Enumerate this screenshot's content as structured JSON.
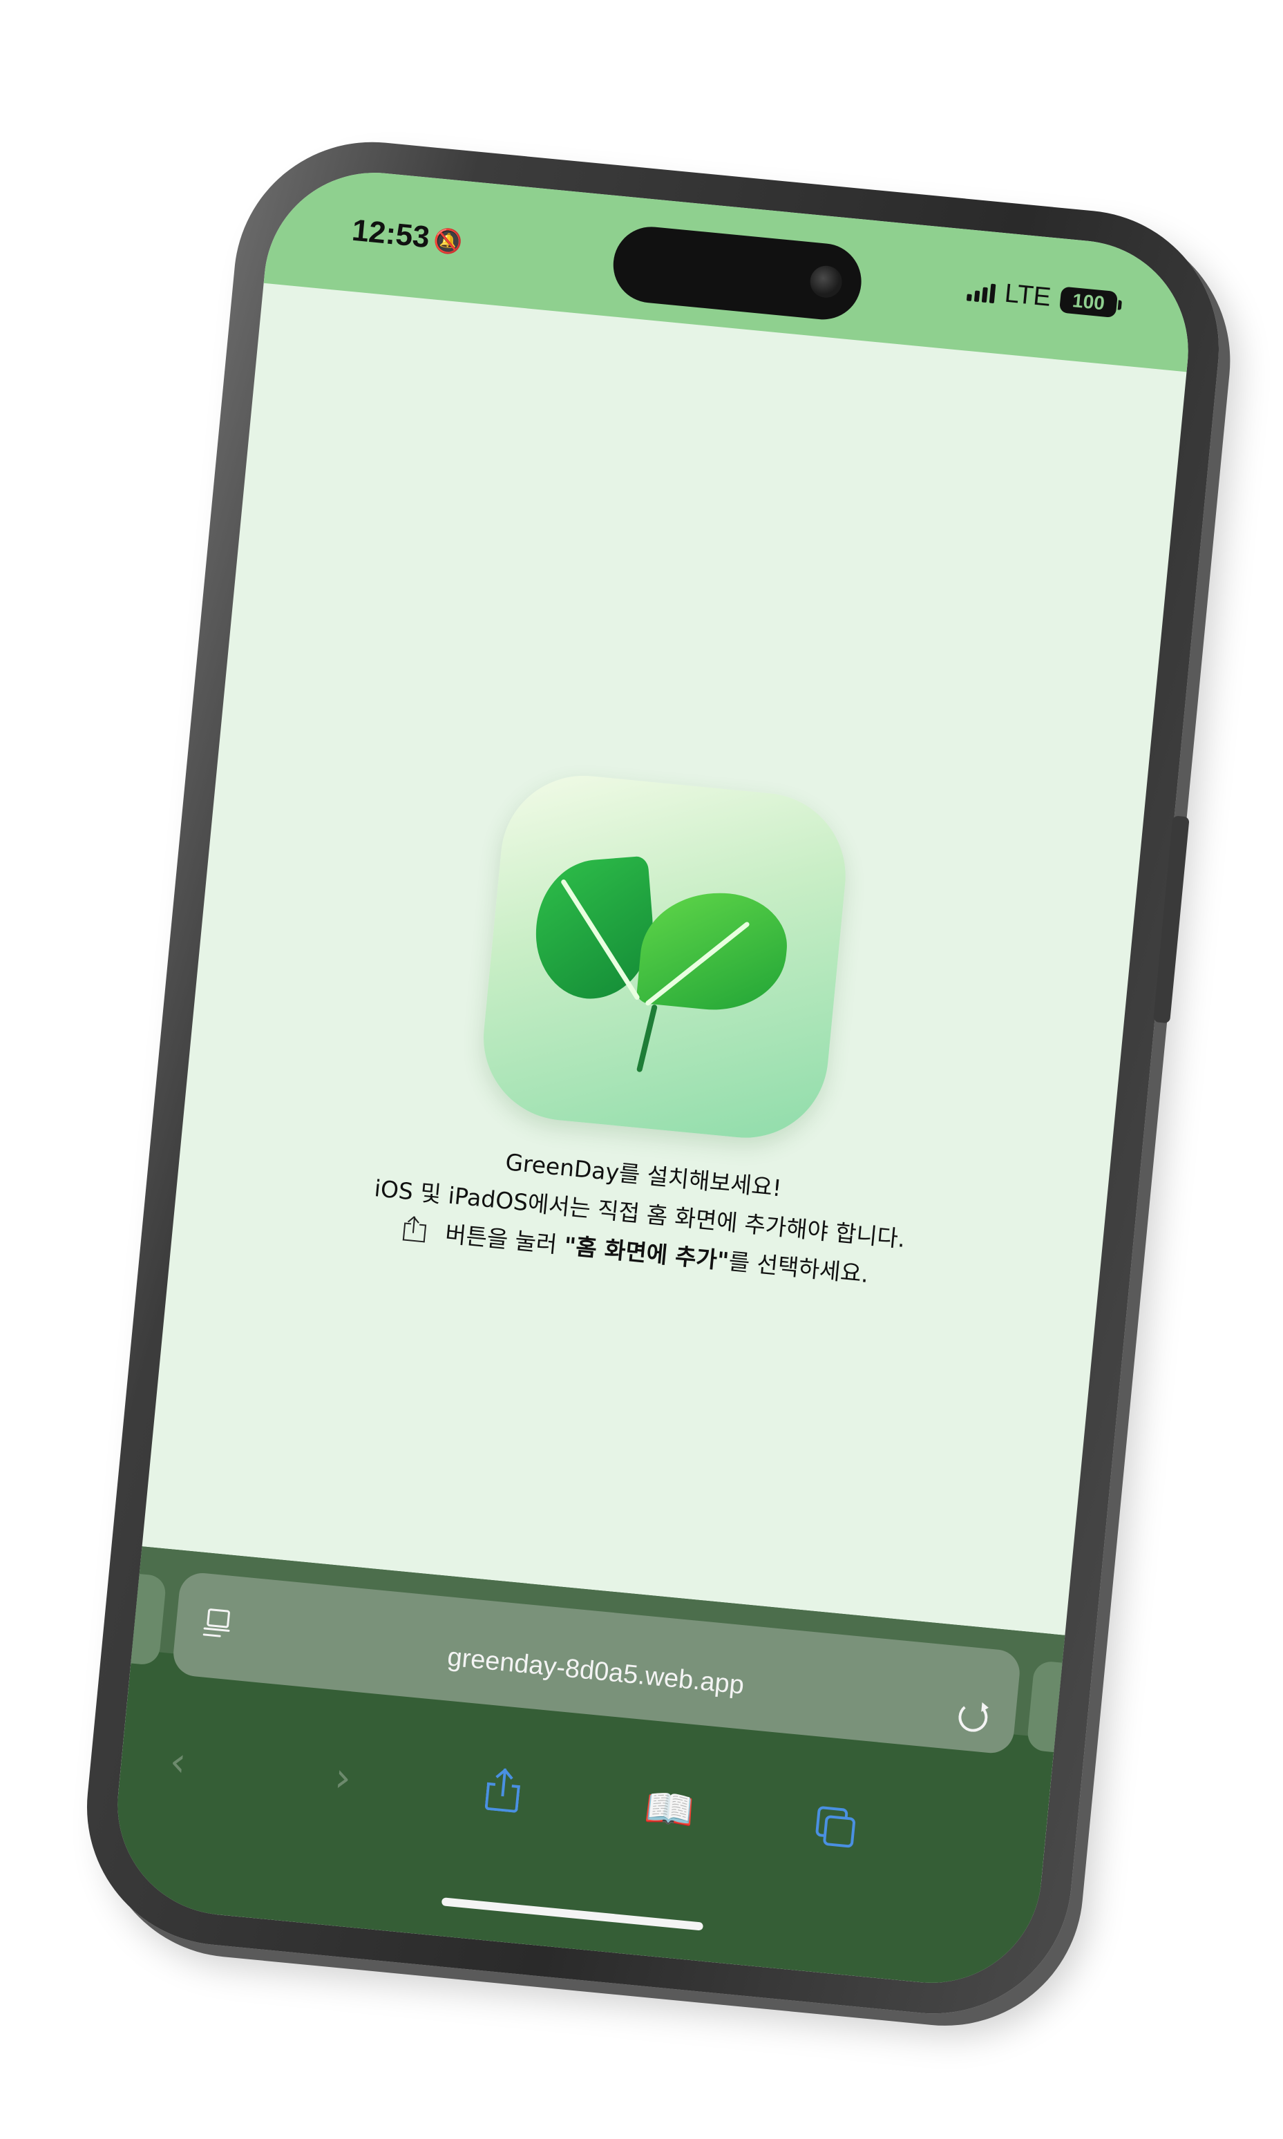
{
  "status_bar": {
    "time": "12:53",
    "network": "LTE",
    "battery": "100",
    "bell_icon": "bell-slash-icon",
    "background_color": "#8fd08f"
  },
  "app": {
    "icon_name": "sprout-leaf-icon",
    "background_color": "#e6f4e6"
  },
  "install_message": {
    "line1": "GreenDay를 설치해보세요!",
    "line2": "iOS 및 iPadOS에서는 직접 홈 화면에 추가해야 합니다.",
    "line3_prefix": " 버튼을 눌러 ",
    "line3_bold": "\"홈 화면에 추가\"",
    "line3_suffix": "를 선택하세요."
  },
  "browser": {
    "url": "greenday-8d0a5.web.app",
    "toolbar_color": "#355e36",
    "accent_color": "#4a90e2",
    "back_glyph": "‹",
    "forward_glyph": "›",
    "bookmarks_glyph": "📖"
  }
}
